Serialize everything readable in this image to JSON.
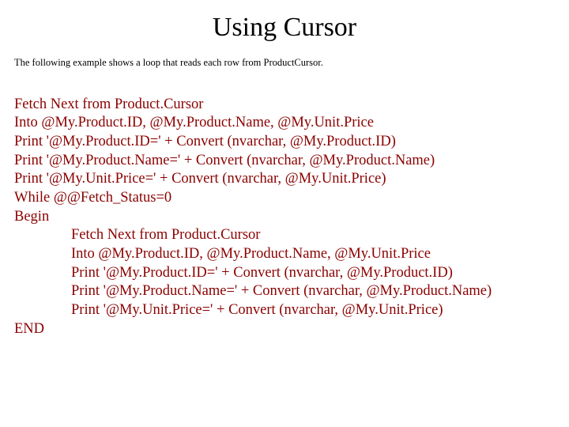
{
  "title": "Using Cursor",
  "intro": "The following example shows a loop that reads each row from ProductCursor.",
  "code": {
    "l1": "Fetch Next from Product.Cursor",
    "l2": "Into @My.Product.ID, @My.Product.Name, @My.Unit.Price",
    "l3": "Print '@My.Product.ID=' + Convert (nvarchar, @My.Product.ID)",
    "l4": "Print '@My.Product.Name=' + Convert (nvarchar, @My.Product.Name)",
    "l5": "Print '@My.Unit.Price=' + Convert (nvarchar, @My.Unit.Price)",
    "l6": "While @@Fetch_Status=0",
    "l7": "Begin",
    "l8": "Fetch Next from Product.Cursor",
    "l9": "Into @My.Product.ID, @My.Product.Name, @My.Unit.Price",
    "l10": "Print '@My.Product.ID=' + Convert (nvarchar, @My.Product.ID)",
    "l11": "Print '@My.Product.Name=' + Convert (nvarchar, @My.Product.Name)",
    "l12": "Print '@My.Unit.Price=' + Convert (nvarchar, @My.Unit.Price)",
    "l13": "END"
  }
}
